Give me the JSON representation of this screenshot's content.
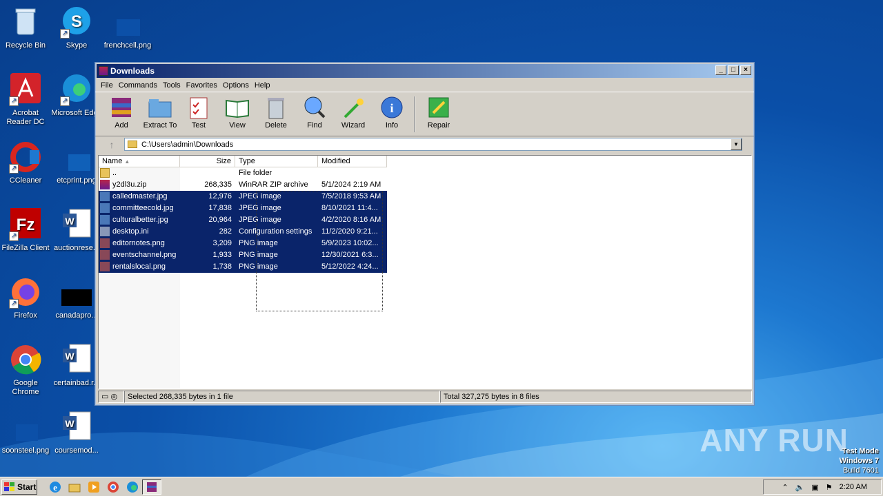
{
  "desktop": {
    "icons": [
      {
        "label": "Recycle Bin",
        "icon": "recycle-bin-icon"
      },
      {
        "label": "Skype",
        "icon": "skype-icon"
      },
      {
        "label": "frenchcell.png",
        "icon": "png-file-icon"
      },
      {
        "label": "Acrobat Reader DC",
        "icon": "acrobat-icon"
      },
      {
        "label": "Microsoft Edge",
        "icon": "edge-icon"
      },
      {
        "label": "CCleaner",
        "icon": "ccleaner-icon"
      },
      {
        "label": "etcprint.png",
        "icon": "png-file-icon"
      },
      {
        "label": "FileZilla Client",
        "icon": "filezilla-icon"
      },
      {
        "label": "auctionrese...",
        "icon": "word-doc-icon"
      },
      {
        "label": "Firefox",
        "icon": "firefox-icon"
      },
      {
        "label": "canadapro...",
        "icon": "black-file-icon"
      },
      {
        "label": "Google Chrome",
        "icon": "chrome-icon"
      },
      {
        "label": "certainbad.r...",
        "icon": "word-doc-icon"
      },
      {
        "label": "soonsteel.png",
        "icon": "png-file-icon"
      },
      {
        "label": "coursemod...",
        "icon": "word-doc-icon"
      }
    ]
  },
  "window": {
    "title": "Downloads",
    "menu": [
      "File",
      "Commands",
      "Tools",
      "Favorites",
      "Options",
      "Help"
    ],
    "toolbar": [
      "Add",
      "Extract To",
      "Test",
      "View",
      "Delete",
      "Find",
      "Wizard",
      "Info",
      "Repair"
    ],
    "address": "C:\\Users\\admin\\Downloads",
    "columns": [
      "Name",
      "Size",
      "Type",
      "Modified"
    ],
    "files": [
      {
        "name": "..",
        "size": "",
        "type": "File folder",
        "modified": "",
        "selected": false
      },
      {
        "name": "y2dl3u.zip",
        "size": "268,335",
        "type": "WinRAR ZIP archive",
        "modified": "5/1/2024 2:19 AM",
        "selected": false
      },
      {
        "name": "calledmaster.jpg",
        "size": "12,976",
        "type": "JPEG image",
        "modified": "7/5/2018 9:53 AM",
        "selected": true
      },
      {
        "name": "committeecold.jpg",
        "size": "17,838",
        "type": "JPEG image",
        "modified": "8/10/2021 11:4...",
        "selected": true
      },
      {
        "name": "culturalbetter.jpg",
        "size": "20,964",
        "type": "JPEG image",
        "modified": "4/2/2020 8:16 AM",
        "selected": true
      },
      {
        "name": "desktop.ini",
        "size": "282",
        "type": "Configuration settings",
        "modified": "11/2/2020 9:21...",
        "selected": true
      },
      {
        "name": "editornotes.png",
        "size": "3,209",
        "type": "PNG image",
        "modified": "5/9/2023 10:02...",
        "selected": true
      },
      {
        "name": "eventschannel.png",
        "size": "1,933",
        "type": "PNG image",
        "modified": "12/30/2021 6:3...",
        "selected": true
      },
      {
        "name": "rentalslocal.png",
        "size": "1,738",
        "type": "PNG image",
        "modified": "5/12/2022 4:24...",
        "selected": true
      }
    ],
    "status_left": "Selected 268,335 bytes in 1 file",
    "status_right": "Total 327,275 bytes in 8 files"
  },
  "taskbar": {
    "start_label": "Start",
    "clock": "2:20 AM"
  },
  "watermark": "ANY RUN",
  "testmode": [
    "Test Mode",
    "Windows 7",
    "Build 7601"
  ]
}
